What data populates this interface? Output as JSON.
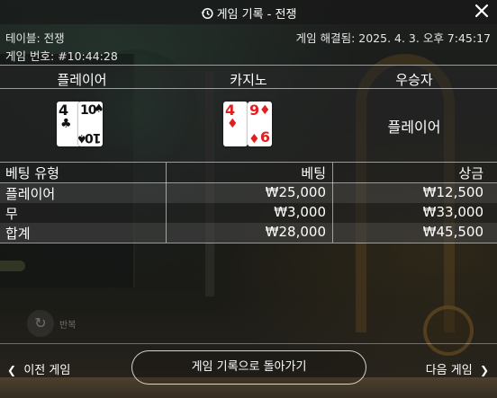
{
  "header": {
    "title": "게임 기록 - 전쟁",
    "close_label": "✕"
  },
  "meta": {
    "table": "테이블: 전쟁",
    "game_number": "게임 번호: #10:44:28",
    "resolved_time": "게임 해결됨: 2025. 4. 3. 오후 7:45:17"
  },
  "hands": {
    "player_label": "플레이어",
    "casino_label": "카지노",
    "winner_label": "우승자",
    "winner_value": "플레이어",
    "player_cards": [
      {
        "rank": "4",
        "suit": "♣",
        "color": "#111111"
      },
      {
        "rank": "10",
        "suit": "♠",
        "color": "#111111"
      }
    ],
    "casino_cards": [
      {
        "rank": "4",
        "suit": "♦",
        "color": "#e02020"
      },
      {
        "rank": "9",
        "suit": "♦",
        "color": "#e02020"
      }
    ]
  },
  "bets": {
    "headers": [
      "베팅 유형",
      "베팅",
      "상금"
    ],
    "rows": [
      [
        "플레이어",
        "₩25,000",
        "₩12,500"
      ],
      [
        "무",
        "₩3,000",
        "₩33,000"
      ],
      [
        "합계",
        "₩28,000",
        "₩45,500"
      ]
    ]
  },
  "repeat_label": "반복",
  "footer": {
    "prev_label": "이전 게임",
    "back_label": "게임 기록으로 돌아가기",
    "next_label": "다음 게임"
  },
  "colors": {
    "card_red": "#e02020",
    "card_black": "#111111"
  }
}
